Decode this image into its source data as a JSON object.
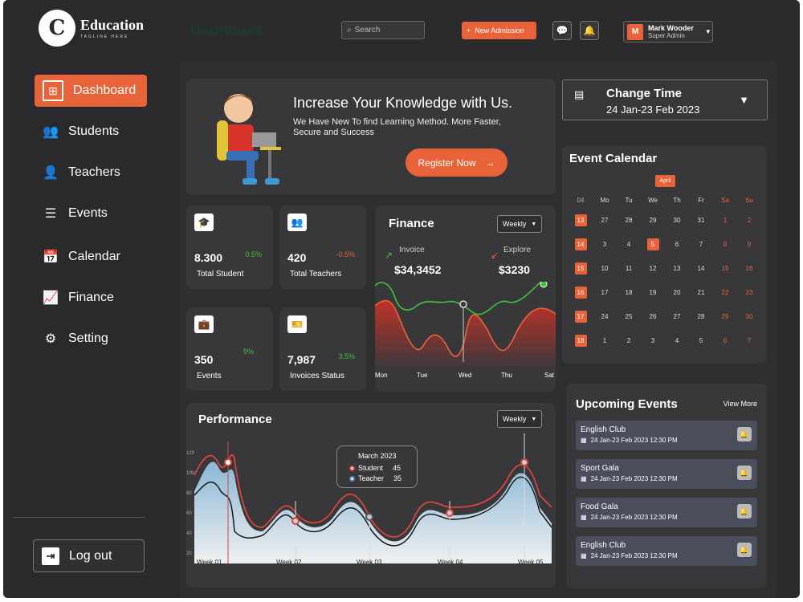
{
  "logo": {
    "mark": "C",
    "title": "Education",
    "tagline": "TAGLINE HERE"
  },
  "sidebar": {
    "items": [
      {
        "label": "Dashboard",
        "icon": "dashboard-icon",
        "glyph": "⊞"
      },
      {
        "label": "Students",
        "icon": "students-icon",
        "glyph": "👥"
      },
      {
        "label": "Teachers",
        "icon": "teachers-icon",
        "glyph": "👤"
      },
      {
        "label": "Events",
        "icon": "events-icon",
        "glyph": "☰"
      },
      {
        "label": "Calendar",
        "icon": "calendar-icon",
        "glyph": "📅"
      },
      {
        "label": "Finance",
        "icon": "finance-icon",
        "glyph": "📈"
      },
      {
        "label": "Setting",
        "icon": "gear-icon",
        "glyph": "⚙"
      }
    ],
    "logout_label": "Log out"
  },
  "header": {
    "page_title": "Dashboard",
    "search_placeholder": "Search",
    "new_admission_label": "New Admission",
    "profile_name": "Mark Wooder",
    "profile_role": "Super Admin",
    "profile_initial": "M"
  },
  "hero": {
    "title": "Increase Your Knowledge with Us.",
    "subtitle": "We Have New To find  Learning Method. More Faster, Secure and Success",
    "button_label": "Register Now"
  },
  "stats": [
    {
      "value": "8.300",
      "change": "0.5%",
      "label": "Total Student",
      "positive": true
    },
    {
      "value": "420",
      "change": "-0.5%",
      "label": "Total Teachers",
      "positive": false
    },
    {
      "value": "350",
      "change": "9%",
      "label": "Events",
      "positive": true
    },
    {
      "value": "7,987",
      "change": "3.5%",
      "label": "Invoices Status",
      "positive": true
    }
  ],
  "finance": {
    "title": "Finance",
    "period": "Weekly",
    "invoice_label": "Invoice",
    "invoice_value": "$34,3452",
    "explore_label": "Explore",
    "explore_value": "$3230",
    "days": [
      "Mon",
      "Tue",
      "Wed",
      "Thu",
      "Sat"
    ]
  },
  "performance": {
    "title": "Performance",
    "period": "Weekly",
    "weeks": [
      "Week 01",
      "Week 02",
      "Week 03",
      "Week 04",
      "Week 05"
    ],
    "yticks": [
      "120",
      "100",
      "80",
      "60",
      "40",
      "20"
    ],
    "tooltip_title": "March 2023",
    "tooltip_student_label": "Student",
    "tooltip_student_value": "45",
    "tooltip_teacher_label": "Teacher",
    "tooltip_teacher_value": "35"
  },
  "change_time": {
    "label": "Change Time",
    "range": "24 Jan-23 Feb 2023"
  },
  "calendar": {
    "title": "Event Calendar",
    "month": "April",
    "headers": [
      "04",
      "Mo",
      "Tu",
      "We",
      "Th",
      "Fr",
      "Sa",
      "Su"
    ],
    "weeks": [
      [
        "13",
        "27",
        "28",
        "29",
        "30",
        "31",
        "1",
        "2"
      ],
      [
        "14",
        "3",
        "4",
        "5",
        "6",
        "7",
        "8",
        "9"
      ],
      [
        "15",
        "10",
        "11",
        "12",
        "13",
        "14",
        "15",
        "16"
      ],
      [
        "16",
        "17",
        "18",
        "19",
        "20",
        "21",
        "22",
        "23"
      ],
      [
        "17",
        "24",
        "25",
        "26",
        "27",
        "28",
        "29",
        "30"
      ],
      [
        "18",
        "1",
        "2",
        "3",
        "4",
        "5",
        "6",
        "7"
      ]
    ],
    "selected": "5"
  },
  "upcoming": {
    "title": "Upcoming Events",
    "view_more": "View More",
    "items": [
      {
        "name": "English Club",
        "date": "24 Jan-23 Feb 2023  12:30 PM"
      },
      {
        "name": "Sport Gala",
        "date": "24 Jan-23 Feb 2023  12:30 PM"
      },
      {
        "name": "Food Gala",
        "date": "24 Jan-23 Feb 2023  12:30 PM"
      },
      {
        "name": "English Club",
        "date": "24 Jan-23 Feb 2023  12:30 PM"
      }
    ]
  },
  "colors": {
    "accent": "#e8633a",
    "bg": "#2b2b2e",
    "card": "#38383b",
    "positive": "#3ec23e",
    "negative": "#e8633a"
  }
}
